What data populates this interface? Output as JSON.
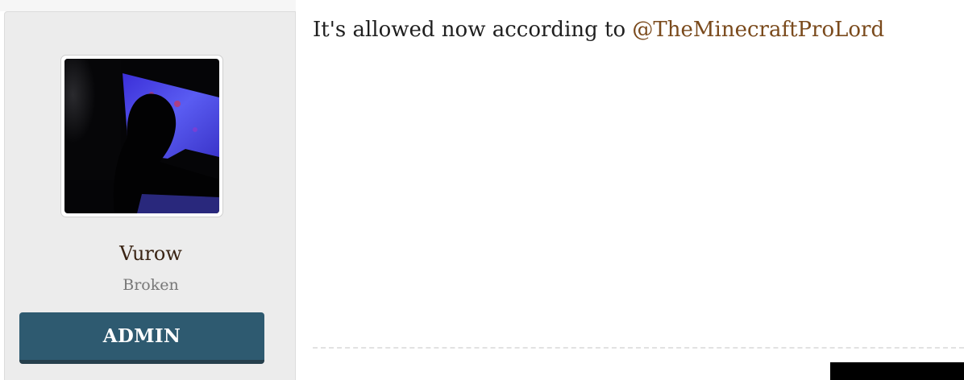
{
  "user": {
    "avatar_icon": "user-avatar-photo",
    "name": "Vurow",
    "title": "Broken",
    "role_badge": "ADMIN"
  },
  "message": {
    "text_before": "It's allowed now according to ",
    "mention": "@TheMinecraftProLord"
  },
  "colors": {
    "mention": "#7a4a1c",
    "badge_bg": "#2e5a70",
    "panel_bg": "#ececec"
  }
}
